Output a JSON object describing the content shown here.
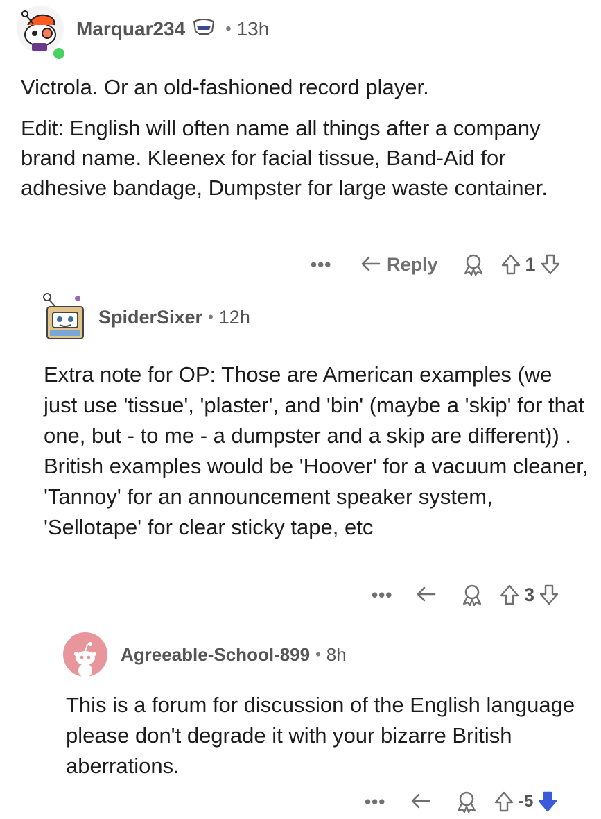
{
  "comments": [
    {
      "username": "Marquar234",
      "time": "13h",
      "body": [
        "Victrola. Or an old-fashioned record player.",
        "Edit: English will often name all things after a company brand name. Kleenex for facial tissue, Band-Aid for adhesive bandage, Dumpster for large waste container."
      ],
      "more": "•••",
      "reply_label": "Reply",
      "vote_count": "1",
      "online_color": "#46d160"
    },
    {
      "username": "SpiderSixer",
      "time": "12h",
      "body": [
        "Extra note for OP: Those are American examples (we just use 'tissue', 'plaster', and 'bin' (maybe a 'skip' for that one, but - to me - a dumpster and a skip are different)) . British examples would be 'Hoover' for a vacuum cleaner, 'Tannoy' for an announcement speaker system, 'Sellotape' for clear sticky tape, etc"
      ],
      "more": "•••",
      "vote_count": "3"
    },
    {
      "username": "Agreeable-School-899",
      "time": "8h",
      "body": [
        "This is a forum for discussion of the English language please don't degrade it with your bizarre British aberrations."
      ],
      "more": "•••",
      "vote_count": "-5"
    }
  ],
  "separator": "•",
  "icons": {
    "reply": "reply-arrow-icon",
    "award": "award-icon",
    "upvote": "upvote-arrow-icon",
    "downvote": "downvote-arrow-icon",
    "more": "more-options-icon"
  },
  "colors": {
    "text": "#1c1c1c",
    "meta": "#555555",
    "icon": "#878a8c",
    "online": "#46d160",
    "avatar3_bg": "#e8959b"
  }
}
